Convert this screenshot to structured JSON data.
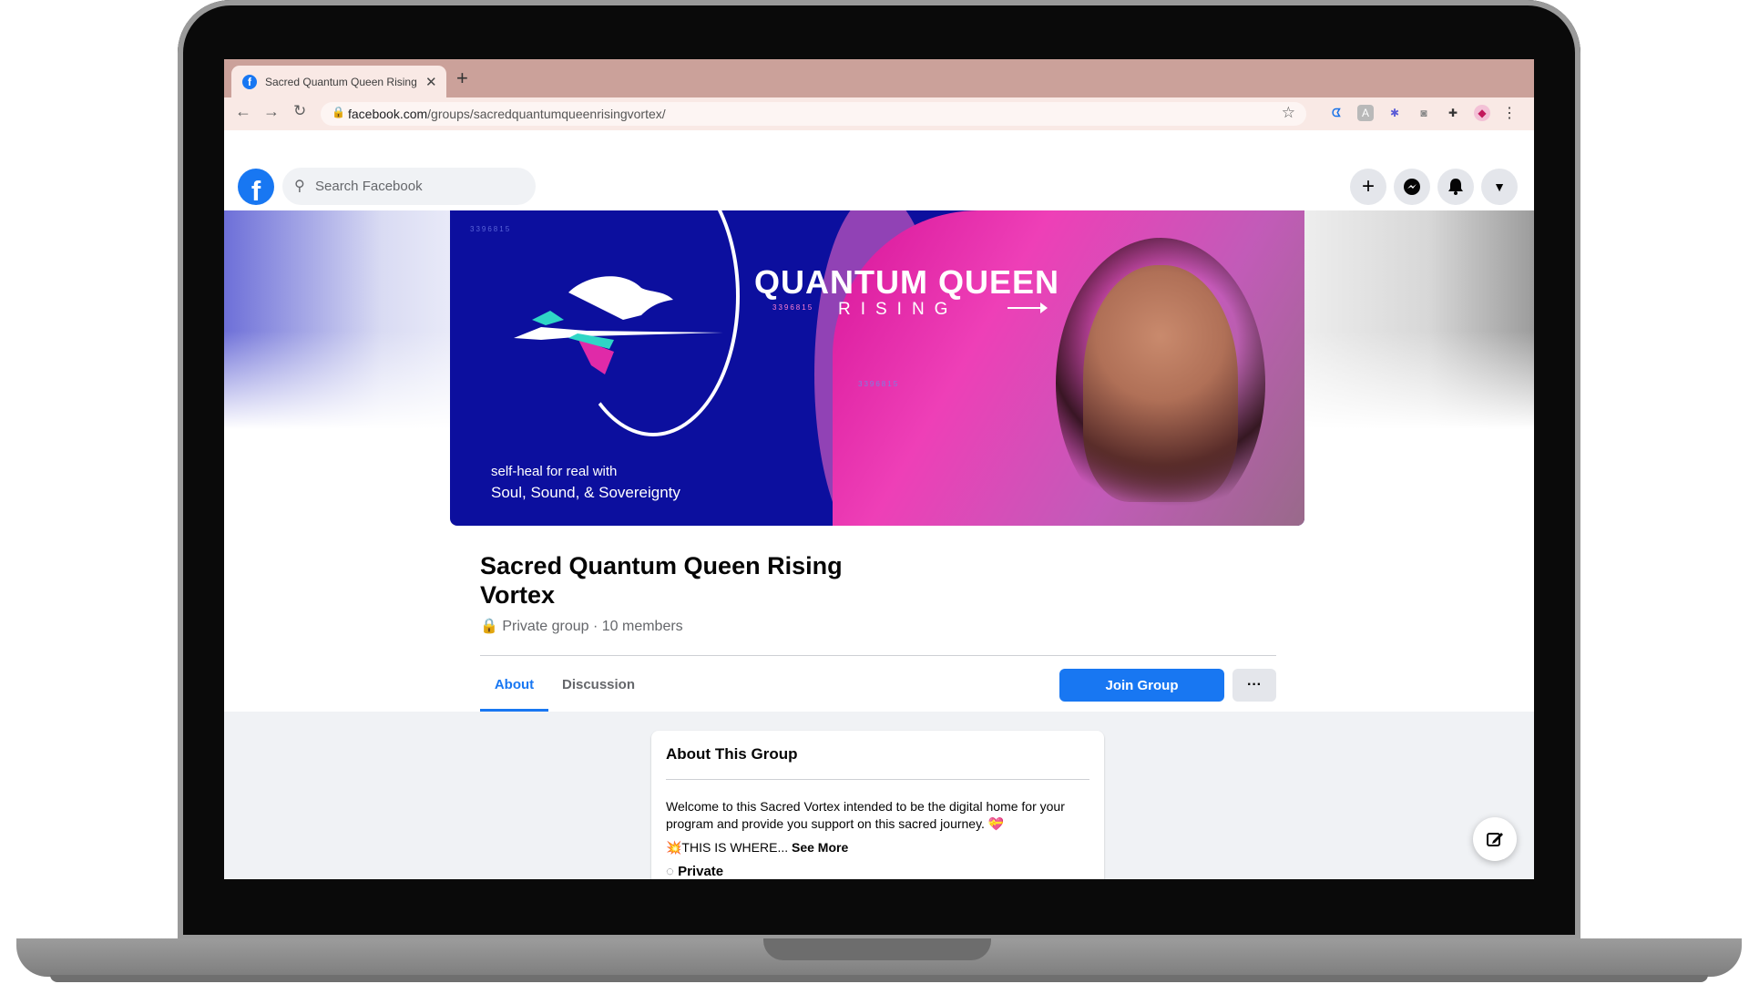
{
  "browser": {
    "tab_title": "Sacred Quantum Queen Rising",
    "url_domain": "facebook.com",
    "url_path": "/groups/sacredquantumqueenrisingvortex/"
  },
  "header": {
    "logo_letter": "f",
    "search_placeholder": "Search Facebook"
  },
  "cover": {
    "title": "QUANTUM QUEEN",
    "subtitle": "RISING",
    "tagline_1": "self-heal for real with",
    "tagline_2": "Soul, Sound, & Sovereignty",
    "code": "3396815"
  },
  "group": {
    "name": "Sacred Quantum Queen Rising Vortex",
    "meta": "Private group · 10 members",
    "tabs": [
      "About",
      "Discussion"
    ],
    "join_label": "Join Group",
    "more_label": "···"
  },
  "about": {
    "heading": "About This Group",
    "description": "Welcome to this Sacred Vortex intended to be the digital home for your program and provide you support on this sacred journey. 💝",
    "teaser": "💥THIS IS WHERE...",
    "see_more": "See More",
    "privacy": "Private"
  },
  "colors": {
    "fb_blue": "#1877f2",
    "tab_bar": "#cba19a",
    "cover_navy": "#0c0f9e",
    "cover_pink": "#e02aa8"
  }
}
